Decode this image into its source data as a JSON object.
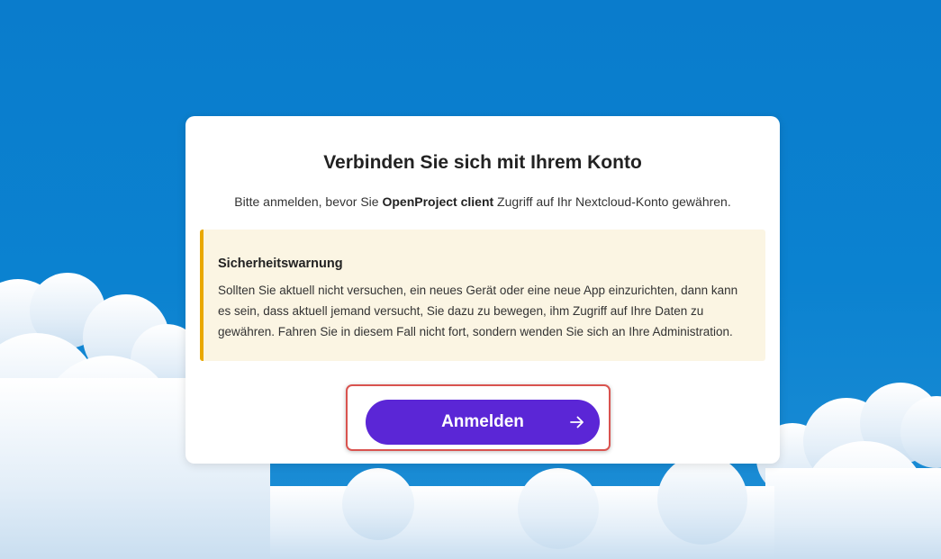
{
  "dialog": {
    "title": "Verbinden Sie sich mit Ihrem Konto",
    "subtitle_before": "Bitte anmelden, bevor Sie ",
    "subtitle_app": "OpenProject client",
    "subtitle_after": " Zugriff auf Ihr Nextcloud-Konto gewähren."
  },
  "warning": {
    "title": "Sicherheitswarnung",
    "text": "Sollten Sie aktuell nicht versuchen, ein neues Gerät oder eine neue App einzurichten, dann kann es sein, dass aktuell jemand versucht, Sie dazu zu bewegen, ihm Zugriff auf Ihre Daten zu gewähren. Fahren Sie in diesem Fall nicht fort, sondern wenden Sie sich an Ihre Administration."
  },
  "login_button": {
    "label": "Anmelden",
    "icon": "arrow-right-icon"
  },
  "colors": {
    "background": "#0b82d0",
    "button": "#5b26d6",
    "warning_accent": "#e9a800",
    "warning_bg": "#fbf5e3",
    "highlight": "#d9534f"
  }
}
